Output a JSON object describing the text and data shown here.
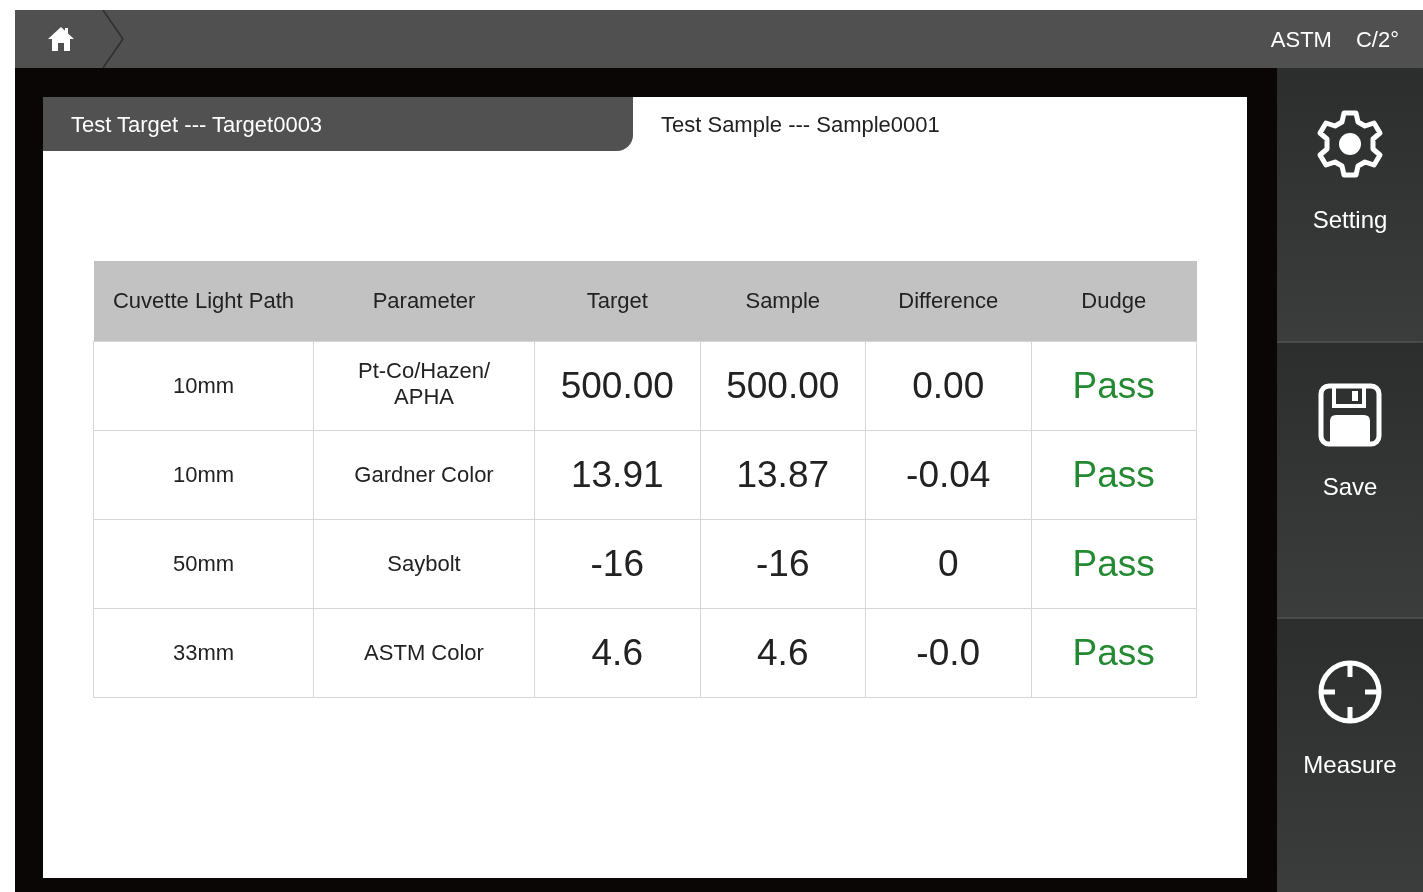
{
  "top_bar": {
    "status": [
      "ASTM",
      "C/2°"
    ]
  },
  "tabs": [
    {
      "label": "Test Target --- Target0003",
      "selected": false
    },
    {
      "label": "Test Sample --- Sample0001",
      "selected": true
    }
  ],
  "table": {
    "columns": [
      "Cuvette Light Path",
      "Parameter",
      "Target",
      "Sample",
      "Difference",
      "Dudge"
    ],
    "rows": [
      {
        "path": "10mm",
        "parameter": "Pt-Co/Hazen/APHA",
        "target": "500.00",
        "sample": "500.00",
        "difference": "0.00",
        "dudge": "Pass",
        "passed": true
      },
      {
        "path": "10mm",
        "parameter": "Gardner Color",
        "target": "13.91",
        "sample": "13.87",
        "difference": "-0.04",
        "dudge": "Pass",
        "passed": true
      },
      {
        "path": "50mm",
        "parameter": "Saybolt",
        "target": "-16",
        "sample": "-16",
        "difference": "0",
        "dudge": "Pass",
        "passed": true
      },
      {
        "path": "33mm",
        "parameter": "ASTM Color",
        "target": "4.6",
        "sample": "4.6",
        "difference": "-0.0",
        "dudge": "Pass",
        "passed": true
      }
    ]
  },
  "sidebar": {
    "items": [
      {
        "kind": "setting",
        "label": "Setting"
      },
      {
        "kind": "save",
        "label": "Save"
      },
      {
        "kind": "measure",
        "label": "Measure"
      }
    ]
  }
}
